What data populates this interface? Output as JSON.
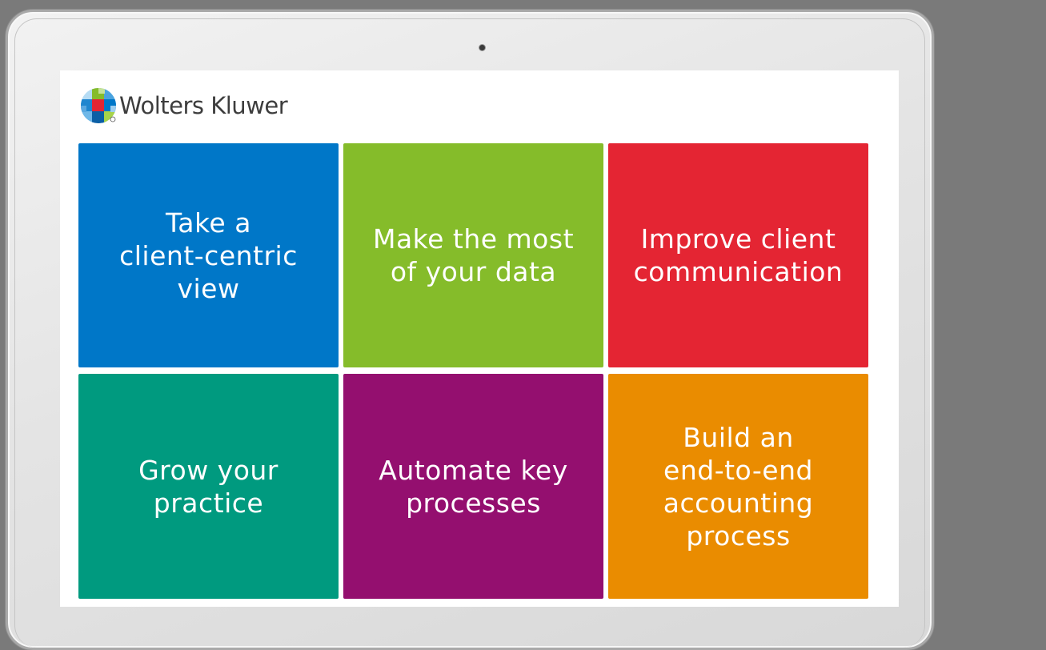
{
  "brand": {
    "name": "Wolters Kluwer",
    "logo_icon": "wolters-kluwer-checkered-globe-icon"
  },
  "tiles": [
    {
      "label": "Take a\nclient-centric\nview",
      "color": "#0077C8"
    },
    {
      "label": "Make the most\nof your data",
      "color": "#85BC2A"
    },
    {
      "label": "Improve client\ncommunication",
      "color": "#E42533"
    },
    {
      "label": "Grow your\npractice",
      "color": "#009A7F"
    },
    {
      "label": "Automate key\nprocesses",
      "color": "#940F6F"
    },
    {
      "label": "Build an\nend-to-end\naccounting\nprocess",
      "color": "#EA8C00"
    }
  ]
}
